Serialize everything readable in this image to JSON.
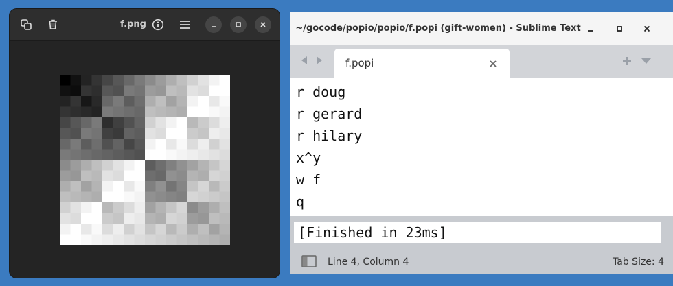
{
  "viewer": {
    "title": "f.png",
    "icons": [
      "copy-icon",
      "trash-icon",
      "info-icon",
      "menu-icon",
      "minimize-icon",
      "maximize-icon",
      "close-icon"
    ],
    "image_description_colors": {
      "dark": "#000000",
      "light": "#ffffff"
    }
  },
  "sublime": {
    "title": "~/gocode/popio/popio/f.popi (gift-women) - Sublime Text",
    "tab": {
      "label": "f.popi"
    },
    "code_lines": [
      "r doug",
      "r gerard",
      "r hilary",
      "x^y",
      "w f",
      "q"
    ],
    "output": "[Finished in 23ms]",
    "status": {
      "position": "Line 4, Column 4",
      "tab_size": "Tab Size: 4"
    },
    "icons": [
      "minimize-icon",
      "maximize-icon",
      "close-icon",
      "nav-left-icon",
      "nav-right-icon",
      "tab-close-icon",
      "add-tab-icon",
      "dropdown-icon",
      "sidebar-toggle-icon"
    ]
  },
  "colors": {
    "desktop": "#3b7bc0",
    "viewer_bg": "#242424",
    "editor_bg": "#ffffff",
    "panel_bg": "#c8cbd0"
  }
}
